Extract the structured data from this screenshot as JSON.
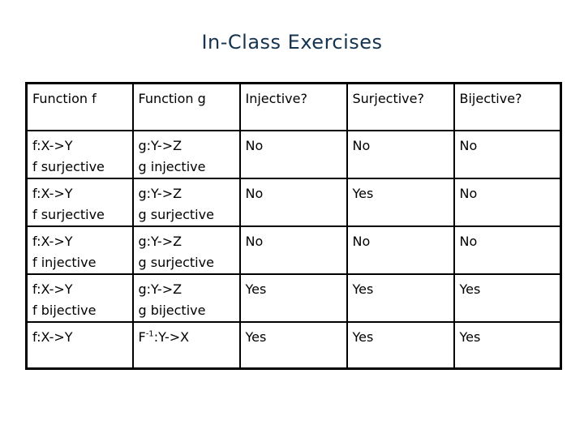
{
  "title": "In-Class Exercises",
  "table": {
    "headers": [
      "Function f",
      "Function g",
      "Injective?",
      "Surjective?",
      "Bijective?"
    ],
    "rows": [
      {
        "f": [
          "f:X->Y",
          "f surjective"
        ],
        "g": [
          "g:Y->Z",
          "g injective"
        ],
        "injective": "No",
        "surjective": "No",
        "bijective": "No"
      },
      {
        "f": [
          "f:X->Y",
          "f surjective"
        ],
        "g": [
          "g:Y->Z",
          "g surjective"
        ],
        "injective": "No",
        "surjective": "Yes",
        "bijective": "No"
      },
      {
        "f": [
          "f:X->Y",
          "f injective"
        ],
        "g": [
          "g:Y->Z",
          "g surjective"
        ],
        "injective": "No",
        "surjective": "No",
        "bijective": "No"
      },
      {
        "f": [
          "f:X->Y",
          "f bijective"
        ],
        "g": [
          "g:Y->Z",
          "g bijective"
        ],
        "injective": "Yes",
        "surjective": "Yes",
        "bijective": "Yes"
      },
      {
        "f": [
          "f:X->Y"
        ],
        "g_inverse": {
          "base": "F",
          "sup": "-1",
          "rest": ":Y->X"
        },
        "injective": "Yes",
        "surjective": "Yes",
        "bijective": "Yes"
      }
    ]
  }
}
